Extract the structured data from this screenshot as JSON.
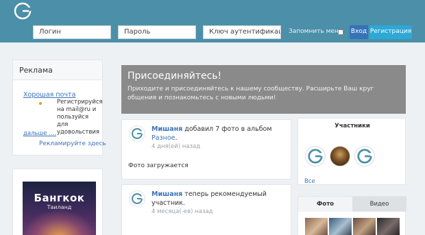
{
  "header": {
    "login_placeholder": "Логин",
    "password_placeholder": "Пароль",
    "authkey_placeholder": "Ключ аутентификации",
    "remember_label": "Запомнить меня",
    "login_button": "Вход",
    "register_button": "Регистрация"
  },
  "sidebar": {
    "ad_title": "Реклама",
    "ad_link": "Хорошая почта",
    "ad_text": "Регистрируйся на mail@ru и пользуйся для удовольствия",
    "ad_more": "дальше ....",
    "ad_here": "Рекламируйте здесь",
    "banner_city": "Бангкок",
    "banner_country": "Таиланд"
  },
  "join": {
    "title": "Присоединяйтесь!",
    "text": "Приходите и присоединяйтесь к нашему сообществу. Расширьте Ваш круг общения и познакомьтесь с новыми людьми!"
  },
  "activity": [
    {
      "user": "Мишаня",
      "action": " добавил 7 фото в альбом ",
      "target": "Разное",
      "suffix": ".",
      "time": "4 дня(ей) назад",
      "body": "Фото загружается"
    },
    {
      "user": "Мишаня",
      "action": " теперь рекомендуемый участник.",
      "target": "",
      "suffix": "",
      "time": "4 месяца(-ев) назад",
      "body": ""
    }
  ],
  "members": {
    "title": "Участники",
    "all_link": "Все"
  },
  "media": {
    "tab_photo": "Фото",
    "tab_video": "Видео"
  },
  "colors": {
    "header": "#4b8fa8",
    "link": "#3a73b6",
    "login_btn": "#3672b8",
    "register_btn": "#2ca9d6",
    "join_bg": "#8a8a8a"
  },
  "icons": {
    "logo": "site-logo-g-icon",
    "member_avatar": "g-avatar-icon"
  }
}
